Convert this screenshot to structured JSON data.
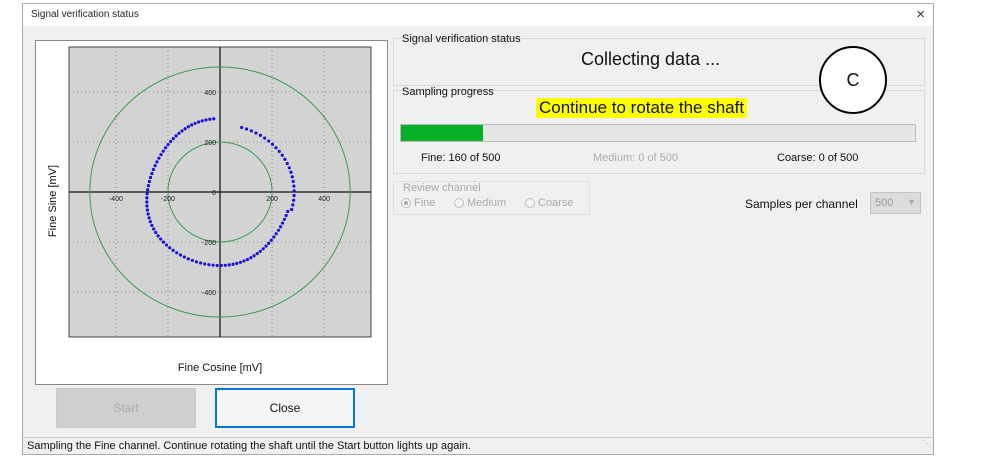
{
  "window": {
    "title": "Signal verification status",
    "close_glyph": "×"
  },
  "plot": {
    "ylabel": "Fine Sine [mV]",
    "xlabel": "Fine Cosine [mV]",
    "x_ticks": [
      "-400",
      "-200",
      "0",
      "200",
      "400"
    ],
    "y_ticks": [
      "400",
      "200",
      "0",
      "-200",
      "-400"
    ],
    "range": [
      -580,
      580
    ],
    "reference_circles_mv": [
      200,
      500
    ],
    "sample_ellipse_mv": {
      "rx": 300,
      "ry": 300,
      "cx": 0,
      "cy": 0
    },
    "plot_bg": "#d3d3d3",
    "sample_color": "#1a10d8",
    "circle_color": "#3a9a50"
  },
  "buttons": {
    "start": "Start",
    "close": "Close"
  },
  "status_group": {
    "label": "Signal verification status",
    "message": "Collecting data ..."
  },
  "sampling_group": {
    "label": "Sampling progress",
    "instruction": "Continue to rotate the shaft",
    "progress_fraction": 0.16,
    "fine": "Fine: 160 of 500",
    "medium": "Medium: 0 of 500",
    "coarse": "Coarse: 0 of 500"
  },
  "review_channel": {
    "label": "Review channel",
    "options": [
      "Fine",
      "Medium",
      "Coarse"
    ]
  },
  "samples_per_channel": {
    "label": "Samples per channel",
    "value": "500"
  },
  "callout": {
    "letter": "C"
  },
  "statusbar": {
    "text": "Sampling the Fine channel. Continue rotating the shaft until the Start button lights up again."
  }
}
